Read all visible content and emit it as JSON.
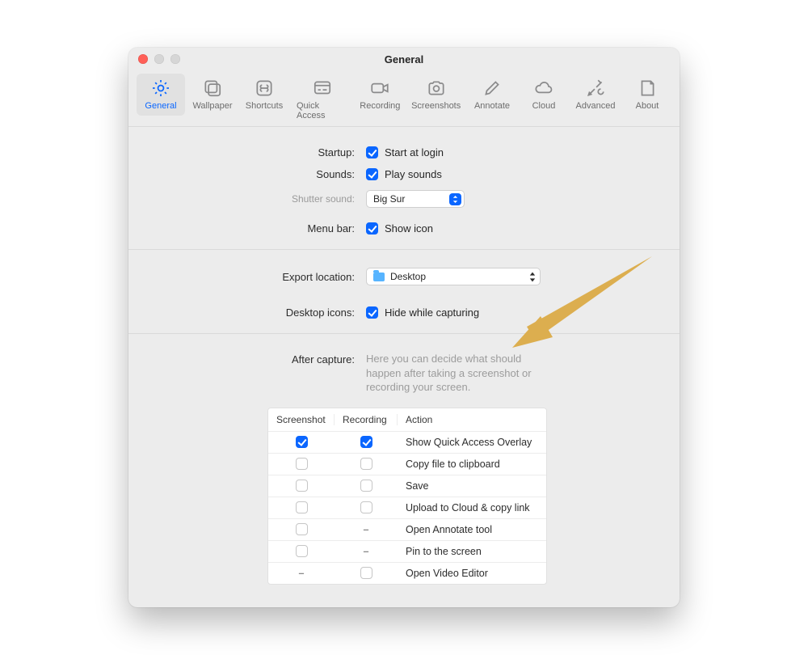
{
  "window": {
    "title": "General"
  },
  "tabs": [
    {
      "id": "general",
      "label": "General"
    },
    {
      "id": "wallpaper",
      "label": "Wallpaper"
    },
    {
      "id": "shortcuts",
      "label": "Shortcuts"
    },
    {
      "id": "quickaccess",
      "label": "Quick Access"
    },
    {
      "id": "recording",
      "label": "Recording"
    },
    {
      "id": "screenshots",
      "label": "Screenshots"
    },
    {
      "id": "annotate",
      "label": "Annotate"
    },
    {
      "id": "cloud",
      "label": "Cloud"
    },
    {
      "id": "advanced",
      "label": "Advanced"
    },
    {
      "id": "about",
      "label": "About"
    }
  ],
  "labels": {
    "startup": "Startup:",
    "sounds": "Sounds:",
    "shutter_sound": "Shutter sound:",
    "menu_bar": "Menu bar:",
    "export_location": "Export location:",
    "desktop_icons": "Desktop icons:",
    "after_capture": "After capture:"
  },
  "options": {
    "start_at_login": "Start at login",
    "play_sounds": "Play sounds",
    "shutter_value": "Big Sur",
    "show_icon": "Show icon",
    "export_value": "Desktop",
    "hide_while_capturing": "Hide while capturing"
  },
  "after_capture_hint": "Here you can decide what should happen after taking a screenshot or recording your screen.",
  "table": {
    "headers": {
      "screenshot": "Screenshot",
      "recording": "Recording",
      "action": "Action"
    },
    "rows": [
      {
        "screenshot": "on",
        "recording": "on",
        "action": "Show Quick Access Overlay"
      },
      {
        "screenshot": "off",
        "recording": "off",
        "action": "Copy file to clipboard"
      },
      {
        "screenshot": "off",
        "recording": "off",
        "action": "Save"
      },
      {
        "screenshot": "off",
        "recording": "off",
        "action": "Upload to Cloud & copy link"
      },
      {
        "screenshot": "off",
        "recording": "dash",
        "action": "Open Annotate tool"
      },
      {
        "screenshot": "off",
        "recording": "dash",
        "action": "Pin to the screen"
      },
      {
        "screenshot": "dash",
        "recording": "off",
        "action": "Open Video Editor"
      }
    ]
  }
}
